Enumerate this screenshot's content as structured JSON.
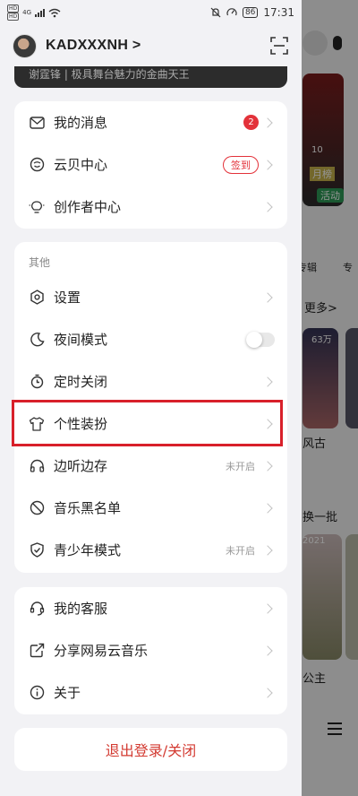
{
  "status_bar": {
    "sim1": "HD",
    "sim2": "HD",
    "network": "4G",
    "battery": "86",
    "time": "17:31"
  },
  "header": {
    "username": "KADXXXNH >"
  },
  "banner": {
    "text": "谢霆锋 | 极具舞台魅力的金曲天王"
  },
  "group1": [
    {
      "label": "我的消息",
      "icon": "mail-icon",
      "badge": "2"
    },
    {
      "label": "云贝中心",
      "icon": "coin-icon",
      "action": "签到"
    },
    {
      "label": "创作者中心",
      "icon": "bulb-icon"
    }
  ],
  "group2": {
    "title": "其他",
    "items": [
      {
        "label": "设置",
        "icon": "settings-icon"
      },
      {
        "label": "夜间模式",
        "icon": "moon-icon"
      },
      {
        "label": "定时关闭",
        "icon": "timer-icon"
      },
      {
        "label": "个性装扮",
        "icon": "shirt-icon"
      },
      {
        "label": "边听边存",
        "icon": "headphones-icon",
        "state": "未开启"
      },
      {
        "label": "音乐黑名单",
        "icon": "block-icon"
      },
      {
        "label": "青少年模式",
        "icon": "shield-icon",
        "state": "未开启"
      }
    ]
  },
  "group3": [
    {
      "label": "我的客服",
      "icon": "headset-icon"
    },
    {
      "label": "分享网易云音乐",
      "icon": "share-icon"
    },
    {
      "label": "关于",
      "icon": "info-icon"
    }
  ],
  "logout": {
    "label": "退出登录/关闭"
  },
  "background": {
    "activity": "活动",
    "album": "专辑",
    "more": "更多>",
    "plays": "63万",
    "song_label": "风古",
    "refresh": "换一批",
    "name": "公主",
    "year": "2021",
    "month": "月榜",
    "day": "10"
  },
  "colors": {
    "accent": "#e3323a",
    "highlight": "#d8202a"
  }
}
